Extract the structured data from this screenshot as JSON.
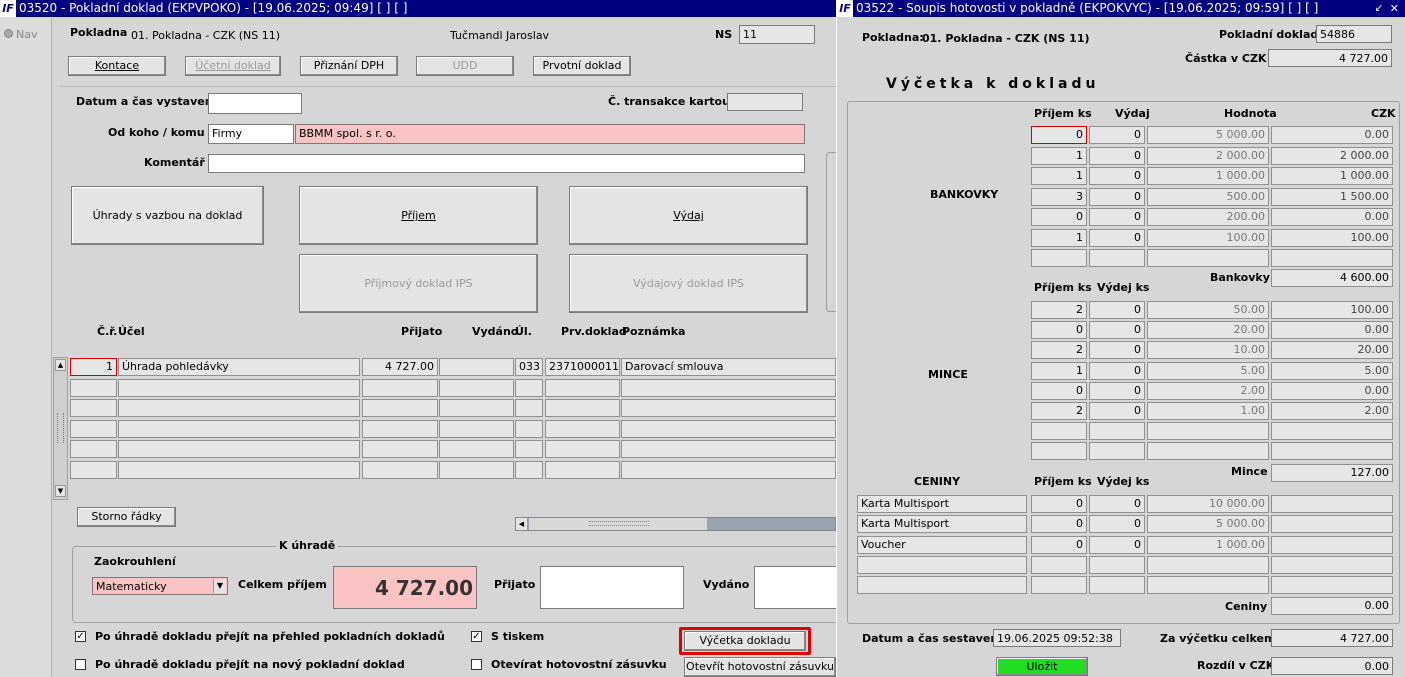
{
  "left": {
    "title": "03520 - Pokladní doklad (EKPVPOKO) - [19.06.2025; 09:49]  [ ]  [ ]",
    "nav_label": "Nav",
    "pokladna_label": "Pokladna",
    "pokladna_value": "01. Pokladna - CZK (NS 11)",
    "user_name": "Tučmandl Jaroslav",
    "ns_label": "NS",
    "ns_value": "11",
    "toolbar": {
      "kontace": "Kontace",
      "ucetni_doklad": "Účetní doklad",
      "priznani_dph": "Přiznání DPH",
      "udd": "UDD",
      "prvotni_doklad": "Prvotní doklad"
    },
    "datum_label": "Datum a čas vystavení",
    "datum_value": "",
    "transakce_label": "Č. transakce kartou",
    "transakce_value": "",
    "od_koho_label": "Od koho / komu",
    "od_koho_type": "Firmy",
    "od_koho_value": "BBMM spol. s r. o.",
    "komentar_label": "Komentář",
    "komentar_value": "",
    "big_buttons": {
      "uhrady": "Úhrady s vazbou na doklad",
      "prijem": "Příjem",
      "vydaj": "Výdaj",
      "prijmovy_ips": "Příjmový doklad IPS",
      "vydajovy_ips": "Výdajový doklad IPS"
    },
    "table": {
      "headers": {
        "cr": "Č.ř.",
        "ucel": "Účel",
        "prijato": "Přijato",
        "vydano": "Vydáno",
        "ul": "Úl.",
        "prv": "Prv.doklad",
        "poznamka": "Poznámka"
      },
      "rows": [
        {
          "cr": "1",
          "ucel": "Úhrada pohledávky",
          "prijato": "4 727.00",
          "vydano": "",
          "ul": "033",
          "prv": "2371000011",
          "poznamka": "Darovací smlouva"
        }
      ]
    },
    "storno_button": "Storno řádky",
    "k_uhrade_label": "K úhradě",
    "zaokrouhleni_label": "Zaokrouhlení",
    "zaokrouhleni_value": "Matematicky",
    "celkem_prijem_label": "Celkem příjem",
    "celkem_prijem_value": "4 727.00",
    "prijato_label": "Přijato",
    "prijato_value": "",
    "vydano_label": "Vydáno",
    "vydano_value": "",
    "chk_prehled_label": "Po úhradě dokladu přejít na přehled pokladních dokladů",
    "chk_prehled_checked": true,
    "chk_novy_label": "Po úhradě dokladu přejít na nový pokladní doklad",
    "chk_novy_checked": false,
    "chk_tisk_label": "S tiskem",
    "chk_tisk_checked": true,
    "chk_zasuvka_label": "Otevírat hotovostní zásuvku",
    "chk_zasuvka_checked": false,
    "vycetka_button": "Výčetka dokladu",
    "otevrit_zasuvku_button": "Otevřít hotovostní zásuvku"
  },
  "right": {
    "title": "03522 - Soupis hotovosti v pokladně (EKPOKVYC) - [19.06.2025; 09:59]  [ ]  [ ]",
    "pokladna_label": "Pokladna:",
    "pokladna_value": "01. Pokladna - CZK (NS 11)",
    "pokladni_doklad_label": "Pokladní doklad",
    "pokladni_doklad_value": "54886",
    "castka_label": "Částka v CZK",
    "castka_value": "4 727.00",
    "heading": "Výčetka k dokladu",
    "hdr_prijem_ks": "Příjem ks",
    "hdr_vydaj": "Výdaj",
    "hdr_hodnota": "Hodnota",
    "hdr_czk": "CZK",
    "bankovky_label": "BANKOVKY",
    "bankovky": [
      {
        "prijem": "0",
        "vydaj": "0",
        "hodnota": "5 000.00",
        "czk": "0.00"
      },
      {
        "prijem": "1",
        "vydaj": "0",
        "hodnota": "2 000.00",
        "czk": "2 000.00"
      },
      {
        "prijem": "1",
        "vydaj": "0",
        "hodnota": "1 000.00",
        "czk": "1 000.00"
      },
      {
        "prijem": "3",
        "vydaj": "0",
        "hodnota": "500.00",
        "czk": "1 500.00"
      },
      {
        "prijem": "0",
        "vydaj": "0",
        "hodnota": "200.00",
        "czk": "0.00"
      },
      {
        "prijem": "1",
        "vydaj": "0",
        "hodnota": "100.00",
        "czk": "100.00"
      },
      {
        "prijem": "",
        "vydaj": "",
        "hodnota": "",
        "czk": ""
      }
    ],
    "bankovky_total_label": "Bankovky",
    "bankovky_total": "4 600.00",
    "hdr2_prijem_ks": "Příjem ks",
    "hdr2_vydaj_ks": "Výdej ks",
    "mince_label": "MINCE",
    "mince": [
      {
        "prijem": "2",
        "vydaj": "0",
        "hodnota": "50.00",
        "czk": "100.00"
      },
      {
        "prijem": "0",
        "vydaj": "0",
        "hodnota": "20.00",
        "czk": "0.00"
      },
      {
        "prijem": "2",
        "vydaj": "0",
        "hodnota": "10.00",
        "czk": "20.00"
      },
      {
        "prijem": "1",
        "vydaj": "0",
        "hodnota": "5.00",
        "czk": "5.00"
      },
      {
        "prijem": "0",
        "vydaj": "0",
        "hodnota": "2.00",
        "czk": "0.00"
      },
      {
        "prijem": "2",
        "vydaj": "0",
        "hodnota": "1.00",
        "czk": "2.00"
      },
      {
        "prijem": "",
        "vydaj": "",
        "hodnota": "",
        "czk": ""
      },
      {
        "prijem": "",
        "vydaj": "",
        "hodnota": "",
        "czk": ""
      }
    ],
    "mince_total_label": "Mince",
    "mince_total": "127.00",
    "ceniny_label": "CENINY",
    "hdr3_prijem_ks": "Příjem ks",
    "hdr3_vydej_ks": "Výdej ks",
    "ceniny": [
      {
        "nazev": "Karta Multisport",
        "prijem": "0",
        "vydaj": "0",
        "hodnota": "10 000.00",
        "czk": ""
      },
      {
        "nazev": "Karta Multisport",
        "prijem": "0",
        "vydaj": "0",
        "hodnota": "5 000.00",
        "czk": ""
      },
      {
        "nazev": "Voucher",
        "prijem": "0",
        "vydaj": "0",
        "hodnota": "1 000.00",
        "czk": ""
      },
      {
        "nazev": "",
        "prijem": "",
        "vydaj": "",
        "hodnota": "",
        "czk": ""
      },
      {
        "nazev": "",
        "prijem": "",
        "vydaj": "",
        "hodnota": "",
        "czk": ""
      }
    ],
    "ceniny_total_label": "Ceniny",
    "ceniny_total": "0.00",
    "datum_sestaveni_label": "Datum a čas sestavení:",
    "datum_sestaveni_value": "19.06.2025 09:52:38",
    "za_vycetku_label": "Za výčetku celkem",
    "za_vycetku_value": "4 727.00",
    "ulozit_button": "Uložit",
    "rozdil_label": "Rozdíl v CZK",
    "rozdil_value": "0.00"
  }
}
